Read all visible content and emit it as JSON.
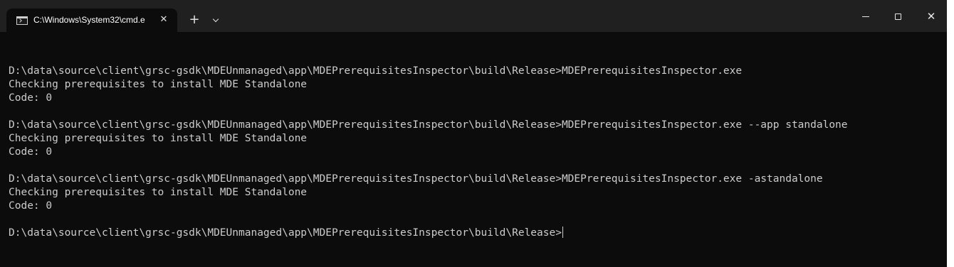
{
  "tab": {
    "icon": "terminal-icon",
    "title": "C:\\Windows\\System32\\cmd.e",
    "close": "✕"
  },
  "tabbar": {
    "new_tab": "+",
    "dropdown_icon": "chevron-down-icon"
  },
  "window_controls": {
    "close": "✕"
  },
  "terminal": {
    "lines": [
      "",
      "D:\\data\\source\\client\\grsc-gsdk\\MDEUnmanaged\\app\\MDEPrerequisitesInspector\\build\\Release>MDEPrerequisitesInspector.exe",
      "Checking prerequisites to install MDE Standalone",
      "Code: 0",
      "",
      "D:\\data\\source\\client\\grsc-gsdk\\MDEUnmanaged\\app\\MDEPrerequisitesInspector\\build\\Release>MDEPrerequisitesInspector.exe --app standalone",
      "Checking prerequisites to install MDE Standalone",
      "Code: 0",
      "",
      "D:\\data\\source\\client\\grsc-gsdk\\MDEUnmanaged\\app\\MDEPrerequisitesInspector\\build\\Release>MDEPrerequisitesInspector.exe -astandalone",
      "Checking prerequisites to install MDE Standalone",
      "Code: 0",
      "",
      "D:\\data\\source\\client\\grsc-gsdk\\MDEUnmanaged\\app\\MDEPrerequisitesInspector\\build\\Release>"
    ]
  },
  "colors": {
    "titlebar": "#202020",
    "terminal_bg": "#0c0c0c",
    "terminal_fg": "#cccccc"
  }
}
